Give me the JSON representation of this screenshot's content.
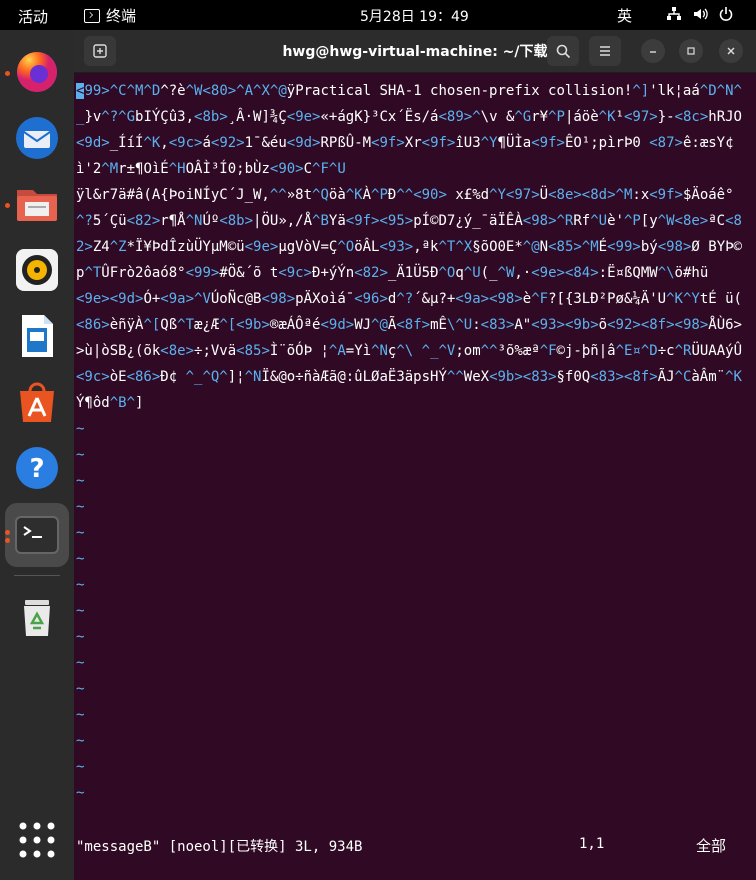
{
  "topbar": {
    "activities": "活动",
    "app_name": "终端",
    "clock": "5月28日  19：49",
    "input_method": "英",
    "tray_icons": [
      "network-icon",
      "volume-icon",
      "power-icon"
    ]
  },
  "dock": {
    "items": [
      {
        "name": "firefox-icon",
        "running": true
      },
      {
        "name": "thunderbird-icon",
        "running": false
      },
      {
        "name": "files-icon",
        "running": true
      },
      {
        "name": "rhythmbox-icon",
        "running": false
      },
      {
        "name": "libreoffice-writer-icon",
        "running": false
      },
      {
        "name": "app-center-icon",
        "running": false
      },
      {
        "name": "help-icon",
        "running": false
      },
      {
        "name": "terminal-icon",
        "running": true,
        "active": true
      },
      {
        "name": "trash-icon",
        "running": false
      },
      {
        "name": "show-apps-icon",
        "running": false
      }
    ],
    "accent": "#e95420"
  },
  "window": {
    "title": "hwg@hwg-virtual-machine: ~/下载",
    "buttons": [
      "new-tab-icon",
      "search-icon",
      "menu-icon",
      "minimize-icon",
      "maximize-icon",
      "close-icon"
    ]
  },
  "editor": {
    "lines": [
      [
        [
          "h",
          "<99>"
        ],
        [
          "h",
          "^C^M^D"
        ],
        [
          "t",
          "^?è"
        ],
        [
          "h",
          "^W<80>^A^X^@"
        ],
        [
          "t",
          "ÿPractical SHA-1 chosen-prefix collision!"
        ],
        [
          "h",
          "^]"
        ],
        [
          "t",
          "'lk¦aá"
        ],
        [
          "h",
          "^D^N^_"
        ],
        [
          "t",
          "}v"
        ],
        [
          "h",
          "^?^G"
        ],
        [
          "t",
          "bIÝÇû3,"
        ],
        [
          "h",
          "<8b>"
        ],
        [
          "t",
          "¸Â·W]¾Ç"
        ],
        [
          "h",
          "<9e>"
        ],
        [
          "t",
          "«+ágK}³Cx´Ës/á"
        ],
        [
          "h",
          "<89>^"
        ],
        [
          "t",
          "\\v &"
        ],
        [
          "h",
          "^G"
        ],
        [
          "t",
          "r¥"
        ],
        [
          "h",
          "^P"
        ],
        [
          "t",
          "|áöè"
        ],
        [
          "h",
          "^K"
        ],
        [
          "t",
          "¹"
        ],
        [
          "h",
          "<97>"
        ],
        [
          "t",
          "}-"
        ],
        [
          "h",
          "<8c>"
        ],
        [
          "t",
          "hRJO"
        ],
        [
          "h",
          "<9d>"
        ],
        [
          "t",
          "_ÍíÍ"
        ],
        [
          "h",
          "^K"
        ],
        [
          "t",
          ","
        ],
        [
          "h",
          "<9c>"
        ],
        [
          "t",
          "á"
        ],
        [
          "h",
          "<92>"
        ],
        [
          "t",
          "1¯&éu"
        ],
        [
          "h",
          "<9d>"
        ],
        [
          "t",
          "RPßÛ-M"
        ],
        [
          "h",
          "<9f>"
        ],
        [
          "t",
          "Xr"
        ],
        [
          "h",
          "<9f>"
        ],
        [
          "t",
          "îU3"
        ],
        [
          "h",
          "^Y"
        ],
        [
          "t",
          "¶ÜÌa"
        ],
        [
          "h",
          "<9f>"
        ],
        [
          "t",
          "ÊO¹;pìrÞ0 "
        ],
        [
          "h",
          "<87>"
        ],
        [
          "t",
          "ê:æsY¢ì'2"
        ],
        [
          "h",
          "^M"
        ],
        [
          "t",
          "r±¶OìÉ"
        ],
        [
          "h",
          "^H"
        ],
        [
          "t",
          "OÂÌ³Í0;bÙz"
        ],
        [
          "h",
          "<90>"
        ],
        [
          "t",
          "C"
        ],
        [
          "h",
          "^F^U"
        ]
      ],
      [
        [
          "t",
          "ÿl&r7ä#â(A{ÞoiNÍyC´J_W,"
        ],
        [
          "h",
          "^^"
        ],
        [
          "t",
          "»8t"
        ],
        [
          "h",
          "^Q"
        ],
        [
          "t",
          "öà"
        ],
        [
          "h",
          "^K"
        ],
        [
          "t",
          "À"
        ],
        [
          "h",
          "^P"
        ],
        [
          "t",
          "Ð"
        ],
        [
          "h",
          "^^<90>"
        ],
        [
          "t",
          " x£%d"
        ],
        [
          "h",
          "^Y<97>"
        ],
        [
          "t",
          "Ü"
        ],
        [
          "h",
          "<8e><8d>^M"
        ],
        [
          "t",
          ":x"
        ],
        [
          "h",
          "<9f>"
        ],
        [
          "t",
          "$Äoáê°"
        ],
        [
          "h",
          "^?"
        ],
        [
          "t",
          "5´Çü"
        ],
        [
          "h",
          "<82>"
        ],
        [
          "t",
          "r¶Å"
        ],
        [
          "h",
          "^N"
        ],
        [
          "t",
          "Úº"
        ],
        [
          "h",
          "<8b>"
        ],
        [
          "t",
          "|ÖU»,/Å"
        ],
        [
          "h",
          "^B"
        ],
        [
          "t",
          "Yä"
        ],
        [
          "h",
          "<9f><95>"
        ],
        [
          "t",
          "pÍ©D7¿ý_¯äÏÊÀ"
        ],
        [
          "h",
          "<98>^R"
        ],
        [
          "t",
          "Rf"
        ],
        [
          "h",
          "^U"
        ],
        [
          "t",
          "è'"
        ],
        [
          "h",
          "^P"
        ],
        [
          "t",
          "[y"
        ],
        [
          "h",
          "^W<8e>"
        ],
        [
          "t",
          "ªC"
        ],
        [
          "h",
          "<82>"
        ],
        [
          "t",
          "Z4"
        ],
        [
          "h",
          "^Z"
        ],
        [
          "t",
          "*Ï¥ÞdÎzùÜYµM©ü"
        ],
        [
          "h",
          "<9e>"
        ],
        [
          "t",
          "µgVòV=Ç"
        ],
        [
          "h",
          "^O"
        ],
        [
          "t",
          "öÂL"
        ],
        [
          "h",
          "<93>"
        ],
        [
          "t",
          ",ªk"
        ],
        [
          "h",
          "^T^X"
        ],
        [
          "t",
          "§õO0E*"
        ],
        [
          "h",
          "^@"
        ],
        [
          "t",
          "N"
        ],
        [
          "h",
          "<85>^M"
        ],
        [
          "t",
          "É"
        ],
        [
          "h",
          "<99>"
        ],
        [
          "t",
          "bý"
        ],
        [
          "h",
          "<98>"
        ],
        [
          "t",
          "Ø BYÞ©p"
        ],
        [
          "h",
          "^T"
        ],
        [
          "t",
          "ÛFrò2ôaó8°"
        ],
        [
          "h",
          "<99>"
        ],
        [
          "t",
          "#Ö&´õ t"
        ],
        [
          "h",
          "<9c>"
        ],
        [
          "t",
          "Ð+ýÝn"
        ],
        [
          "h",
          "<82>"
        ],
        [
          "t",
          "_Ä1Ü5Ð"
        ],
        [
          "h",
          "^O"
        ],
        [
          "t",
          "q"
        ],
        [
          "h",
          "^U"
        ],
        [
          "t",
          "(_"
        ],
        [
          "h",
          "^W"
        ],
        [
          "t",
          ",·"
        ],
        [
          "h",
          "<9e><84>"
        ],
        [
          "t",
          ":Ë¤ßQMW"
        ],
        [
          "h",
          "^\\"
        ],
        [
          "t",
          "ö#hü"
        ]
      ],
      [
        [
          "h",
          "<9e><9d>"
        ],
        [
          "t",
          "Ó+"
        ],
        [
          "h",
          "<9a>^V"
        ],
        [
          "t",
          "ÚoÑc@B"
        ],
        [
          "h",
          "<98>"
        ],
        [
          "t",
          "pÄXoìá¯"
        ],
        [
          "h",
          "<96>"
        ],
        [
          "t",
          "d"
        ],
        [
          "h",
          "^?"
        ],
        [
          "t",
          "´&µ?+"
        ],
        [
          "h",
          "<9a><98>"
        ],
        [
          "t",
          "è"
        ],
        [
          "h",
          "^F"
        ],
        [
          "t",
          "?[{3LÐ²Pø&¼Ä'U"
        ],
        [
          "h",
          "^K^Y"
        ],
        [
          "t",
          "tÉ ü( "
        ],
        [
          "h",
          "<86>"
        ],
        [
          "t",
          "èñÿÀ"
        ],
        [
          "h",
          "^["
        ],
        [
          "t",
          "Qß"
        ],
        [
          "h",
          "^T"
        ],
        [
          "t",
          "æ¿Æ"
        ],
        [
          "h",
          "^["
        ],
        [
          "h",
          "<9b>"
        ],
        [
          "t",
          "®æÁÔªé"
        ],
        [
          "h",
          "<9d>"
        ],
        [
          "t",
          "WJ"
        ],
        [
          "h",
          "^@"
        ],
        [
          "t",
          "Ã"
        ],
        [
          "h",
          "<8f>"
        ],
        [
          "t",
          "mÊ"
        ],
        [
          "h",
          "\\^U"
        ],
        [
          "t",
          ":"
        ],
        [
          "h",
          "<83>"
        ],
        [
          "t",
          "A\""
        ],
        [
          "h",
          "<93><9b>"
        ],
        [
          "t",
          "õ"
        ],
        [
          "h",
          "<92><8f><98>"
        ],
        [
          "t",
          "ÅÙ6>>ù|òSB¿(õk"
        ],
        [
          "h",
          "<8e>"
        ],
        [
          "t",
          "÷;Vvä"
        ],
        [
          "h",
          "<85>"
        ],
        [
          "t",
          "Ì¨õÓÞ ¦"
        ],
        [
          "h",
          "^A"
        ],
        [
          "t",
          "=Yì"
        ],
        [
          "h",
          "^N"
        ],
        [
          "t",
          "ç"
        ],
        [
          "h",
          "^\\ ^_^V"
        ],
        [
          "t",
          ";om"
        ],
        [
          "h",
          "^^"
        ],
        [
          "t",
          "³õ%æª"
        ],
        [
          "h",
          "^F"
        ],
        [
          "t",
          "©j-þñ|â"
        ],
        [
          "h",
          "^E¤^D"
        ],
        [
          "t",
          "÷c"
        ],
        [
          "h",
          "^R"
        ],
        [
          "t",
          "ÜUAAýÛ"
        ],
        [
          "h",
          "<9c>"
        ],
        [
          "t",
          "òE"
        ],
        [
          "h",
          "<86>"
        ],
        [
          "t",
          "Ð¢ "
        ],
        [
          "h",
          "^_^Q^"
        ],
        [
          "t",
          "]¦"
        ],
        [
          "h",
          "^N"
        ],
        [
          "t",
          "Ï&@o÷ñàÆã@:ûLØaË3äpsHÝ"
        ],
        [
          "h",
          "^^"
        ],
        [
          "t",
          "WeX"
        ],
        [
          "h",
          "<9b><83>"
        ],
        [
          "t",
          "§f0Q"
        ],
        [
          "h",
          "<83><8f>"
        ],
        [
          "t",
          "ÃJ"
        ],
        [
          "h",
          "^C"
        ],
        [
          "t",
          "àÂm¨"
        ],
        [
          "h",
          "^K"
        ],
        [
          "t",
          "Ý¶ôd"
        ],
        [
          "h",
          "^B^"
        ],
        [
          "t",
          "]"
        ]
      ]
    ],
    "tilde": "~",
    "tilde_count": 15,
    "status_file": "\"messageB\" [noeol][已转换] 3L, 934B",
    "status_pos": "1,1",
    "status_pct": "全部",
    "colors": {
      "hex": "#5bb1f0",
      "bg": "#300a24"
    }
  }
}
